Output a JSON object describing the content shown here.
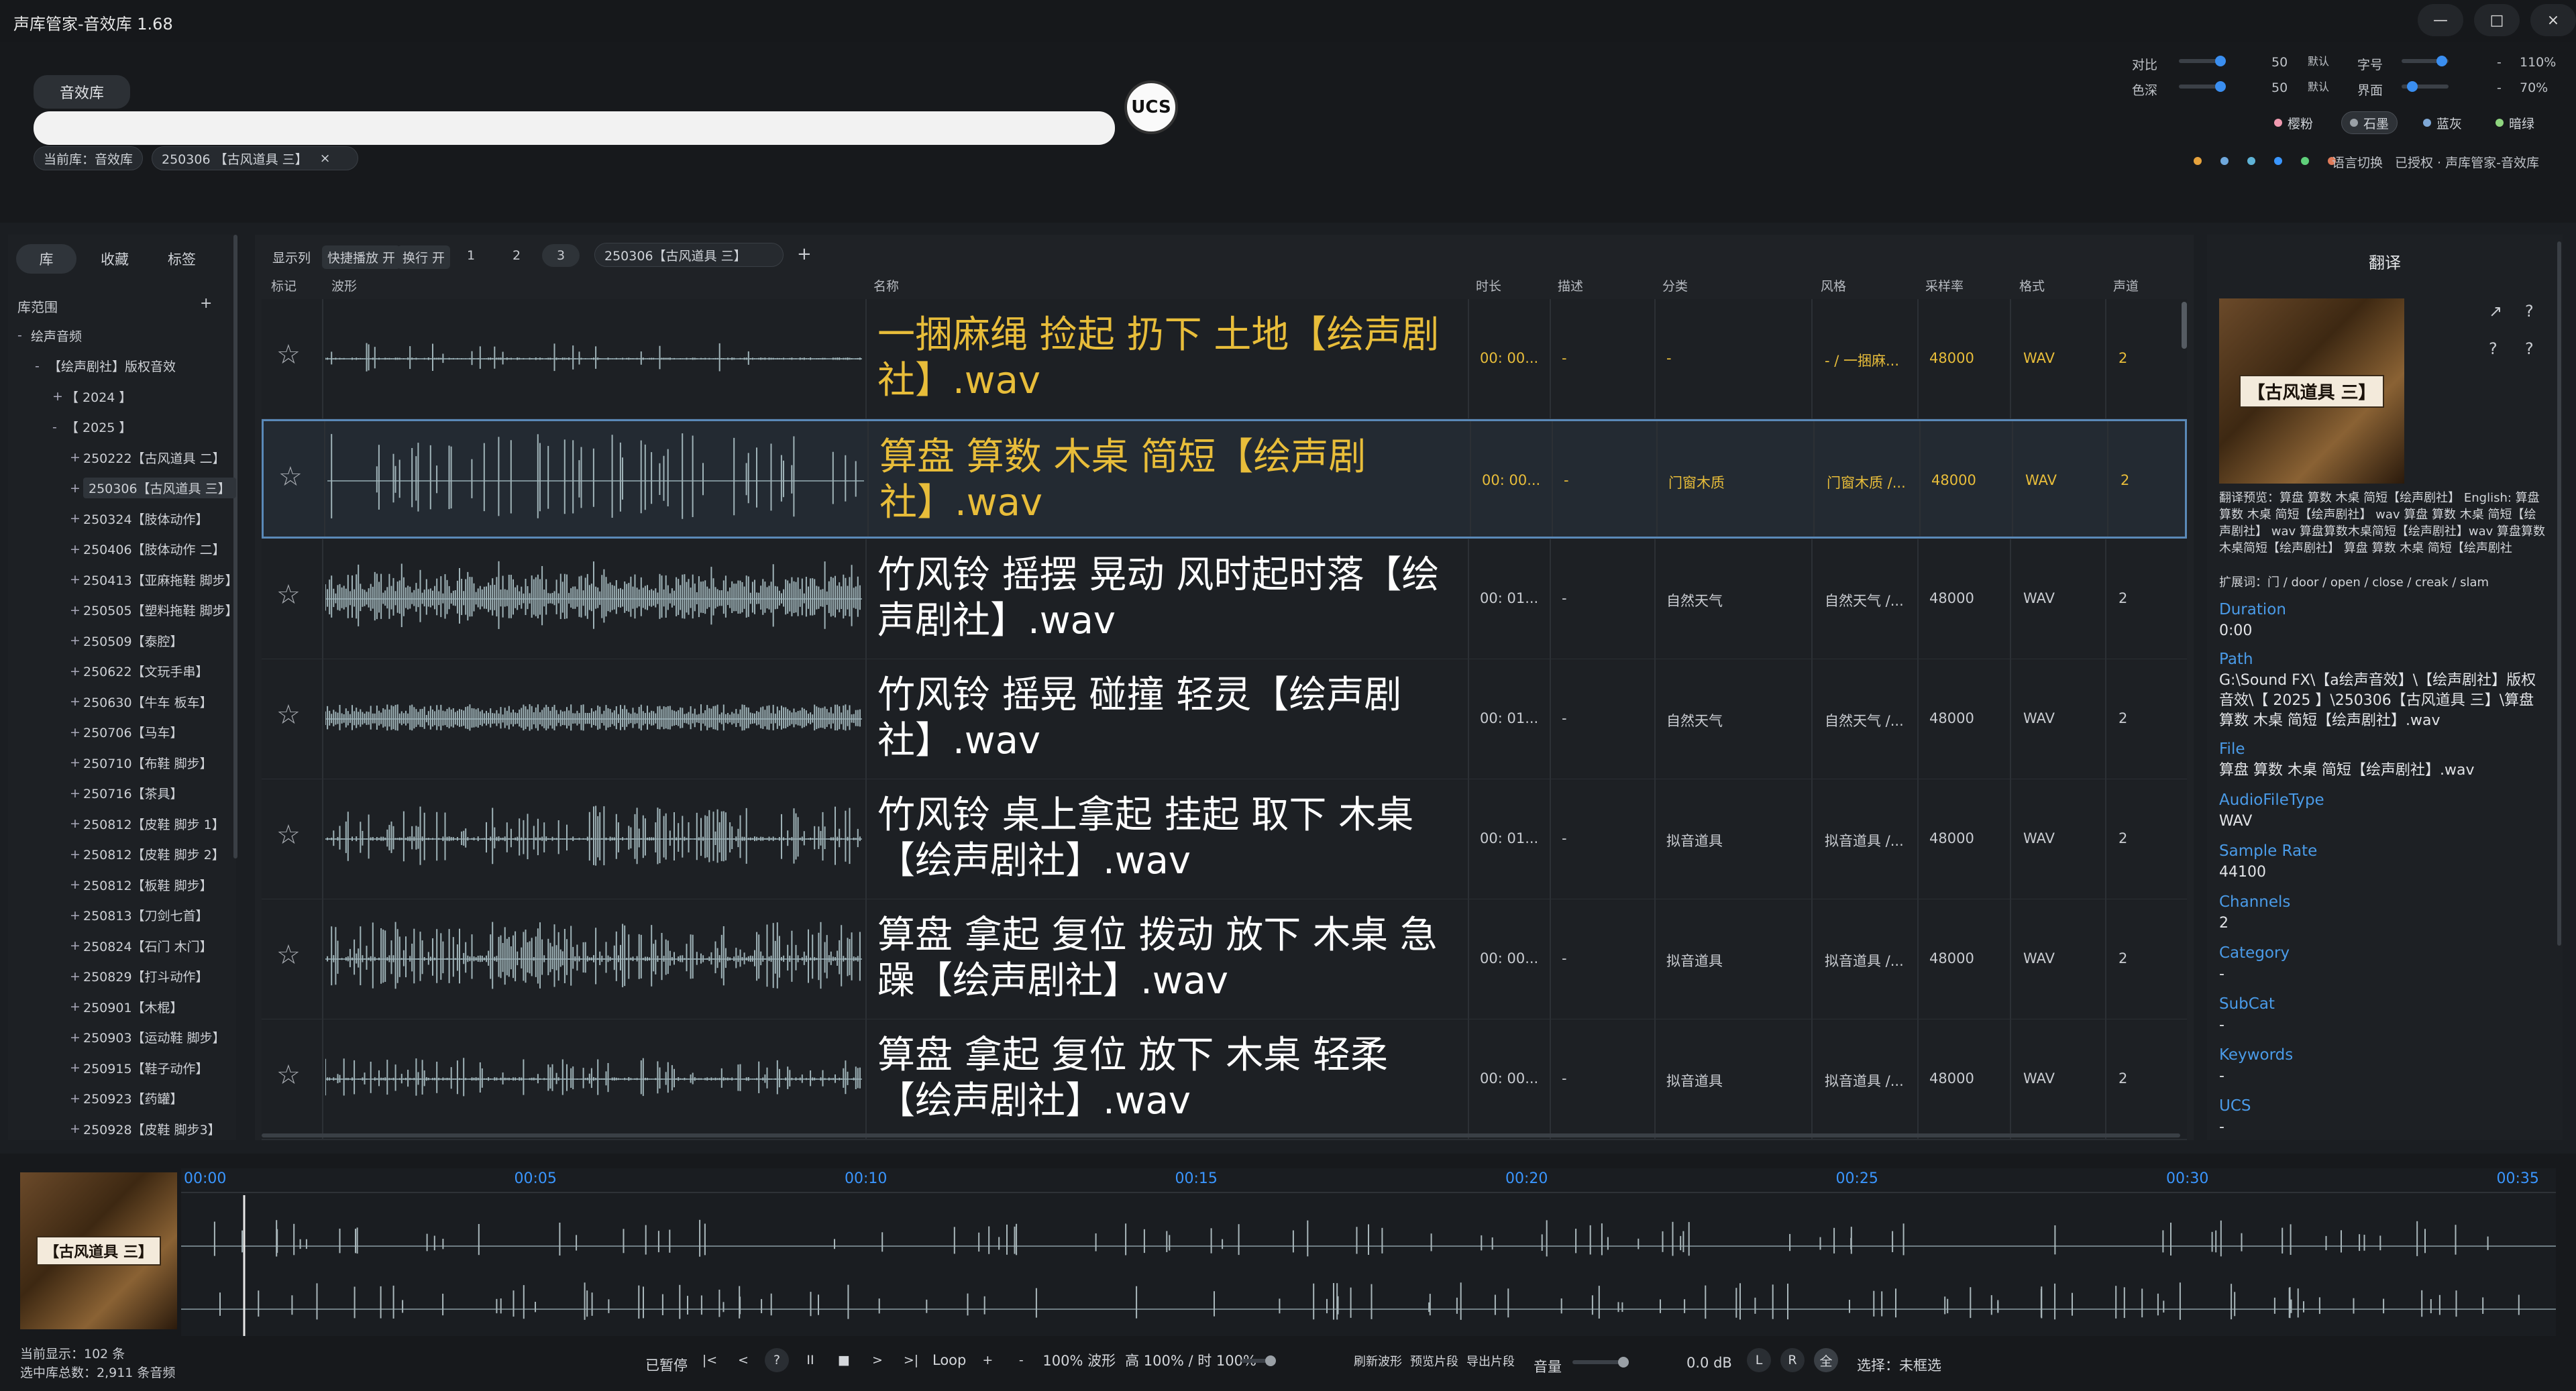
{
  "app": {
    "title": "声库管家-音效库  1.68"
  },
  "window_buttons": {
    "min": "—",
    "max": "□",
    "close": "×"
  },
  "header": {
    "library_tab": "音效库",
    "search": {
      "value": "",
      "placeholder": ""
    },
    "logo_text": "UCS",
    "breadcrumb": {
      "current_lib": "当前库：音效库",
      "folder": "250306 【古风道具 三】",
      "close": "×"
    }
  },
  "settings": {
    "contrast": {
      "label": "对比",
      "value": "50",
      "default": "默认"
    },
    "saturation": {
      "label": "色深",
      "value": "50",
      "default": "默认"
    },
    "font": {
      "label": "字号",
      "minus": "-",
      "value": "110%"
    },
    "ui": {
      "label": "界面",
      "minus": "-",
      "value": "70%"
    },
    "themes": [
      {
        "label": "樱粉",
        "color": "#f19ab0"
      },
      {
        "label": "石墨",
        "color": "#9aa0a6"
      },
      {
        "label": "蓝灰",
        "color": "#7fa8d6"
      },
      {
        "label": "暗绿",
        "color": "#8fd67f"
      }
    ],
    "dots": [
      "#e6a23c",
      "#6fa8dc",
      "#5fb3d6",
      "#3a96ff",
      "#5fd07a",
      "#e07b5a"
    ],
    "lang_switch": "语言切换",
    "license": "已授权 · 声库管家-音效库"
  },
  "sidebar": {
    "tabs": [
      "库",
      "收藏",
      "标签"
    ],
    "range_label": "库范围",
    "add": "+",
    "tree": [
      {
        "tog": "-",
        "label": "绘声音频",
        "indent": 0
      },
      {
        "tog": "-",
        "label": "【绘声剧社】版权音效",
        "indent": 1
      },
      {
        "tog": "+",
        "label": "【 2024 】",
        "indent": 2
      },
      {
        "tog": "-",
        "label": "【 2025 】",
        "indent": 2
      },
      {
        "tog": "+",
        "label": "250222【古风道具 二】",
        "indent": 3
      },
      {
        "tog": "+",
        "label": "250306【古风道具 三】",
        "indent": 3,
        "selected": true
      },
      {
        "tog": "+",
        "label": "250324【肢体动作】",
        "indent": 3
      },
      {
        "tog": "+",
        "label": "250406【肢体动作 二】",
        "indent": 3
      },
      {
        "tog": "+",
        "label": "250413【亚麻拖鞋 脚步】",
        "indent": 3
      },
      {
        "tog": "+",
        "label": "250505【塑料拖鞋 脚步】",
        "indent": 3
      },
      {
        "tog": "+",
        "label": "250509【泰腔】",
        "indent": 3
      },
      {
        "tog": "+",
        "label": "250622【文玩手串】",
        "indent": 3
      },
      {
        "tog": "+",
        "label": "250630【牛车 板车】",
        "indent": 3
      },
      {
        "tog": "+",
        "label": "250706【马车】",
        "indent": 3
      },
      {
        "tog": "+",
        "label": "250710【布鞋 脚步】",
        "indent": 3
      },
      {
        "tog": "+",
        "label": "250716【茶具】",
        "indent": 3
      },
      {
        "tog": "+",
        "label": "250812【皮鞋 脚步 1】",
        "indent": 3
      },
      {
        "tog": "+",
        "label": "250812【皮鞋 脚步 2】",
        "indent": 3
      },
      {
        "tog": "+",
        "label": "250812【板鞋 脚步】",
        "indent": 3
      },
      {
        "tog": "+",
        "label": "250813【刀剑七首】",
        "indent": 3
      },
      {
        "tog": "+",
        "label": "250824【石门 木门】",
        "indent": 3
      },
      {
        "tog": "+",
        "label": "250829【打斗动作】",
        "indent": 3
      },
      {
        "tog": "+",
        "label": "250901【木棍】",
        "indent": 3
      },
      {
        "tog": "+",
        "label": "250903【运动鞋 脚步】",
        "indent": 3
      },
      {
        "tog": "+",
        "label": "250915【鞋子动作】",
        "indent": 3
      },
      {
        "tog": "+",
        "label": "250923【药罐】",
        "indent": 3
      },
      {
        "tog": "+",
        "label": "250928【皮鞋 脚步3】",
        "indent": 3
      }
    ]
  },
  "toolbar": {
    "display_cols": "显示列",
    "quick_play": "快捷播放 开",
    "wrap": "换行 开",
    "pages": [
      "1",
      "2",
      "3"
    ],
    "tab": "250306【古风道具 三】",
    "add_tab": "+"
  },
  "table": {
    "headers": [
      "标记",
      "波形",
      "名称",
      "时长",
      "描述",
      "分类",
      "风格",
      "采样率",
      "格式",
      "声道"
    ],
    "rows": [
      {
        "name": "一捆麻绳 捡起 扔下 土地【绘声剧社】.wav",
        "duration": "00: 00...",
        "desc": "-",
        "category": "-",
        "style": "- / 一捆麻...",
        "rate": "48000",
        "format": "WAV",
        "channels": "2",
        "highlight": true,
        "selected": false,
        "wave": "sparse1"
      },
      {
        "name": "算盘 算数 木桌 简短【绘声剧社】.wav",
        "duration": "00: 00...",
        "desc": "-",
        "category": "门窗木质",
        "style": "门窗木质 /...",
        "rate": "48000",
        "format": "WAV",
        "channels": "2",
        "highlight": true,
        "selected": true,
        "wave": "clicks"
      },
      {
        "name": "竹风铃  摇摆 晃动 风时起时落【绘声剧社】.wav",
        "duration": "00: 01...",
        "desc": "-",
        "category": "自然天气",
        "style": "自然天气 /...",
        "rate": "48000",
        "format": "WAV",
        "channels": "2",
        "highlight": false,
        "selected": false,
        "wave": "dense"
      },
      {
        "name": "竹风铃 摇晃 碰撞 轻灵【绘声剧社】.wav",
        "duration": "00: 01...",
        "desc": "-",
        "category": "自然天气",
        "style": "自然天气 /...",
        "rate": "48000",
        "format": "WAV",
        "channels": "2",
        "highlight": false,
        "selected": false,
        "wave": "steady"
      },
      {
        "name": "竹风铃 桌上拿起 挂起 取下 木桌【绘声剧社】.wav",
        "duration": "00: 01...",
        "desc": "-",
        "category": "拟音道具",
        "style": "拟音道具 /...",
        "rate": "48000",
        "format": "WAV",
        "channels": "2",
        "highlight": false,
        "selected": false,
        "wave": "bursts"
      },
      {
        "name": "算盘 拿起 复位 拨动 放下 木桌 急躁【绘声剧社】.wav",
        "duration": "00: 00...",
        "desc": "-",
        "category": "拟音道具",
        "style": "拟音道具 /...",
        "rate": "48000",
        "format": "WAV",
        "channels": "2",
        "highlight": false,
        "selected": false,
        "wave": "heavy"
      },
      {
        "name": "算盘 拿起 复位 放下 木桌  轻柔【绘声剧社】.wav",
        "duration": "00: 00...",
        "desc": "-",
        "category": "拟音道具",
        "style": "拟音道具 /...",
        "rate": "48000",
        "format": "WAV",
        "channels": "2",
        "highlight": false,
        "selected": false,
        "wave": "light"
      }
    ]
  },
  "right_panel": {
    "title": "翻译",
    "cover_text": "【古风道具 三】",
    "icons": [
      "↗",
      "?",
      "?",
      "?"
    ],
    "translate_preview": "翻译预览：算盘 算数 木桌 简短【绘声剧社】 English: 算盘 算数 木桌 简短【绘声剧社】 wav 算盘 算数 木桌 简短【绘声剧社】 wav 算盘算数木桌简短【绘声剧社】wav 算盘算数木桌简短【绘声剧社】 算盘 算数 木桌 简短【绘声剧社",
    "expand_words": "扩展词：门 / door / open / close / creak / slam",
    "fields": [
      {
        "label": "Duration",
        "value": "0:00"
      },
      {
        "label": "Path",
        "value": "G:\\Sound FX\\【a绘声音效】\\【绘声剧社】版权音效\\【 2025 】\\250306【古风道具 三】\\算盘 算数 木桌 简短【绘声剧社】.wav"
      },
      {
        "label": "File",
        "value": "算盘 算数 木桌 简短【绘声剧社】.wav"
      },
      {
        "label": "AudioFileType",
        "value": "WAV"
      },
      {
        "label": "Sample Rate",
        "value": "44100"
      },
      {
        "label": "Channels",
        "value": "2"
      },
      {
        "label": "Category",
        "value": "-"
      },
      {
        "label": "SubCat",
        "value": "-"
      },
      {
        "label": "Keywords",
        "value": "-"
      },
      {
        "label": "UCS",
        "value": "-"
      }
    ]
  },
  "player": {
    "cover_text": "【古风道具 三】",
    "time_labels": [
      "00:00",
      "00:05",
      "00:10",
      "00:15",
      "00:20",
      "00:25",
      "00:30",
      "00:35"
    ],
    "status_shown": "当前显示：102 条",
    "status_total": "选中库总数：2,911 条音频",
    "paused": "已暂停",
    "btn_first": "|<",
    "btn_prev": "<",
    "btn_help": "?",
    "btn_pause": "II",
    "btn_stop": "■",
    "btn_next": ">",
    "btn_last": ">|",
    "loop": "Loop",
    "plus": "+",
    "minus": "-",
    "zoom": "100% 波形",
    "height_zoom": "高 100% / 时 100%",
    "refresh": "刷新波形",
    "preview": "预览片段",
    "export": "导出片段",
    "volume_label": "音量",
    "volume_db": "0.0 dB",
    "ch_l": "L",
    "ch_r": "R",
    "ch_all": "全",
    "selection": "选择：未框选"
  }
}
